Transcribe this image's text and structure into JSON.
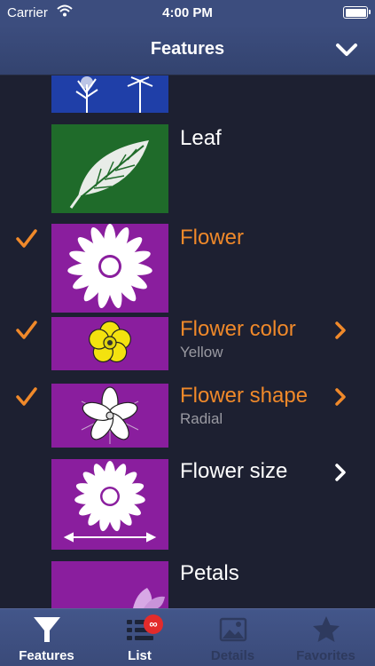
{
  "status_bar": {
    "carrier": "Carrier",
    "time": "4:00 PM"
  },
  "nav": {
    "title": "Features",
    "done_icon": "chevron-down-icon"
  },
  "rows": [
    {
      "title": "",
      "subtitle": "",
      "checked": false,
      "has_disclosure": false,
      "thumb": "trees-thumbnail",
      "thumb_color": "#1f3fa8"
    },
    {
      "title": "Leaf",
      "subtitle": "",
      "checked": false,
      "has_disclosure": false,
      "thumb": "leaf-thumbnail",
      "thumb_color": "#1f6b2a"
    },
    {
      "title": "Flower",
      "subtitle": "",
      "checked": true,
      "has_disclosure": false,
      "thumb": "flower-thumbnail",
      "thumb_color": "#8a1e9e"
    },
    {
      "title": "Flower color",
      "subtitle": "Yellow",
      "checked": true,
      "has_disclosure": true,
      "thumb": "yellow-flower-thumbnail",
      "thumb_color": "#8a1e9e"
    },
    {
      "title": "Flower shape",
      "subtitle": "Radial",
      "checked": true,
      "has_disclosure": true,
      "thumb": "radial-flower-thumbnail",
      "thumb_color": "#8a1e9e"
    },
    {
      "title": "Flower size",
      "subtitle": "",
      "checked": false,
      "has_disclosure": true,
      "thumb": "flower-size-thumbnail",
      "thumb_color": "#8a1e9e"
    },
    {
      "title": "Petals",
      "subtitle": "",
      "checked": false,
      "has_disclosure": false,
      "thumb": "petals-thumbnail",
      "thumb_color": "#8a1e9e"
    }
  ],
  "tabs": [
    {
      "label": "Features",
      "icon": "funnel-icon",
      "active": true
    },
    {
      "label": "List",
      "icon": "list-icon",
      "active": true,
      "badge": "∞"
    },
    {
      "label": "Details",
      "icon": "image-icon",
      "active": false
    },
    {
      "label": "Favorites",
      "icon": "star-icon",
      "active": false
    }
  ],
  "colors": {
    "accent": "#f0892a",
    "background": "#1d2031",
    "bar": "#3c4d7e",
    "badge": "#e32b2b"
  }
}
